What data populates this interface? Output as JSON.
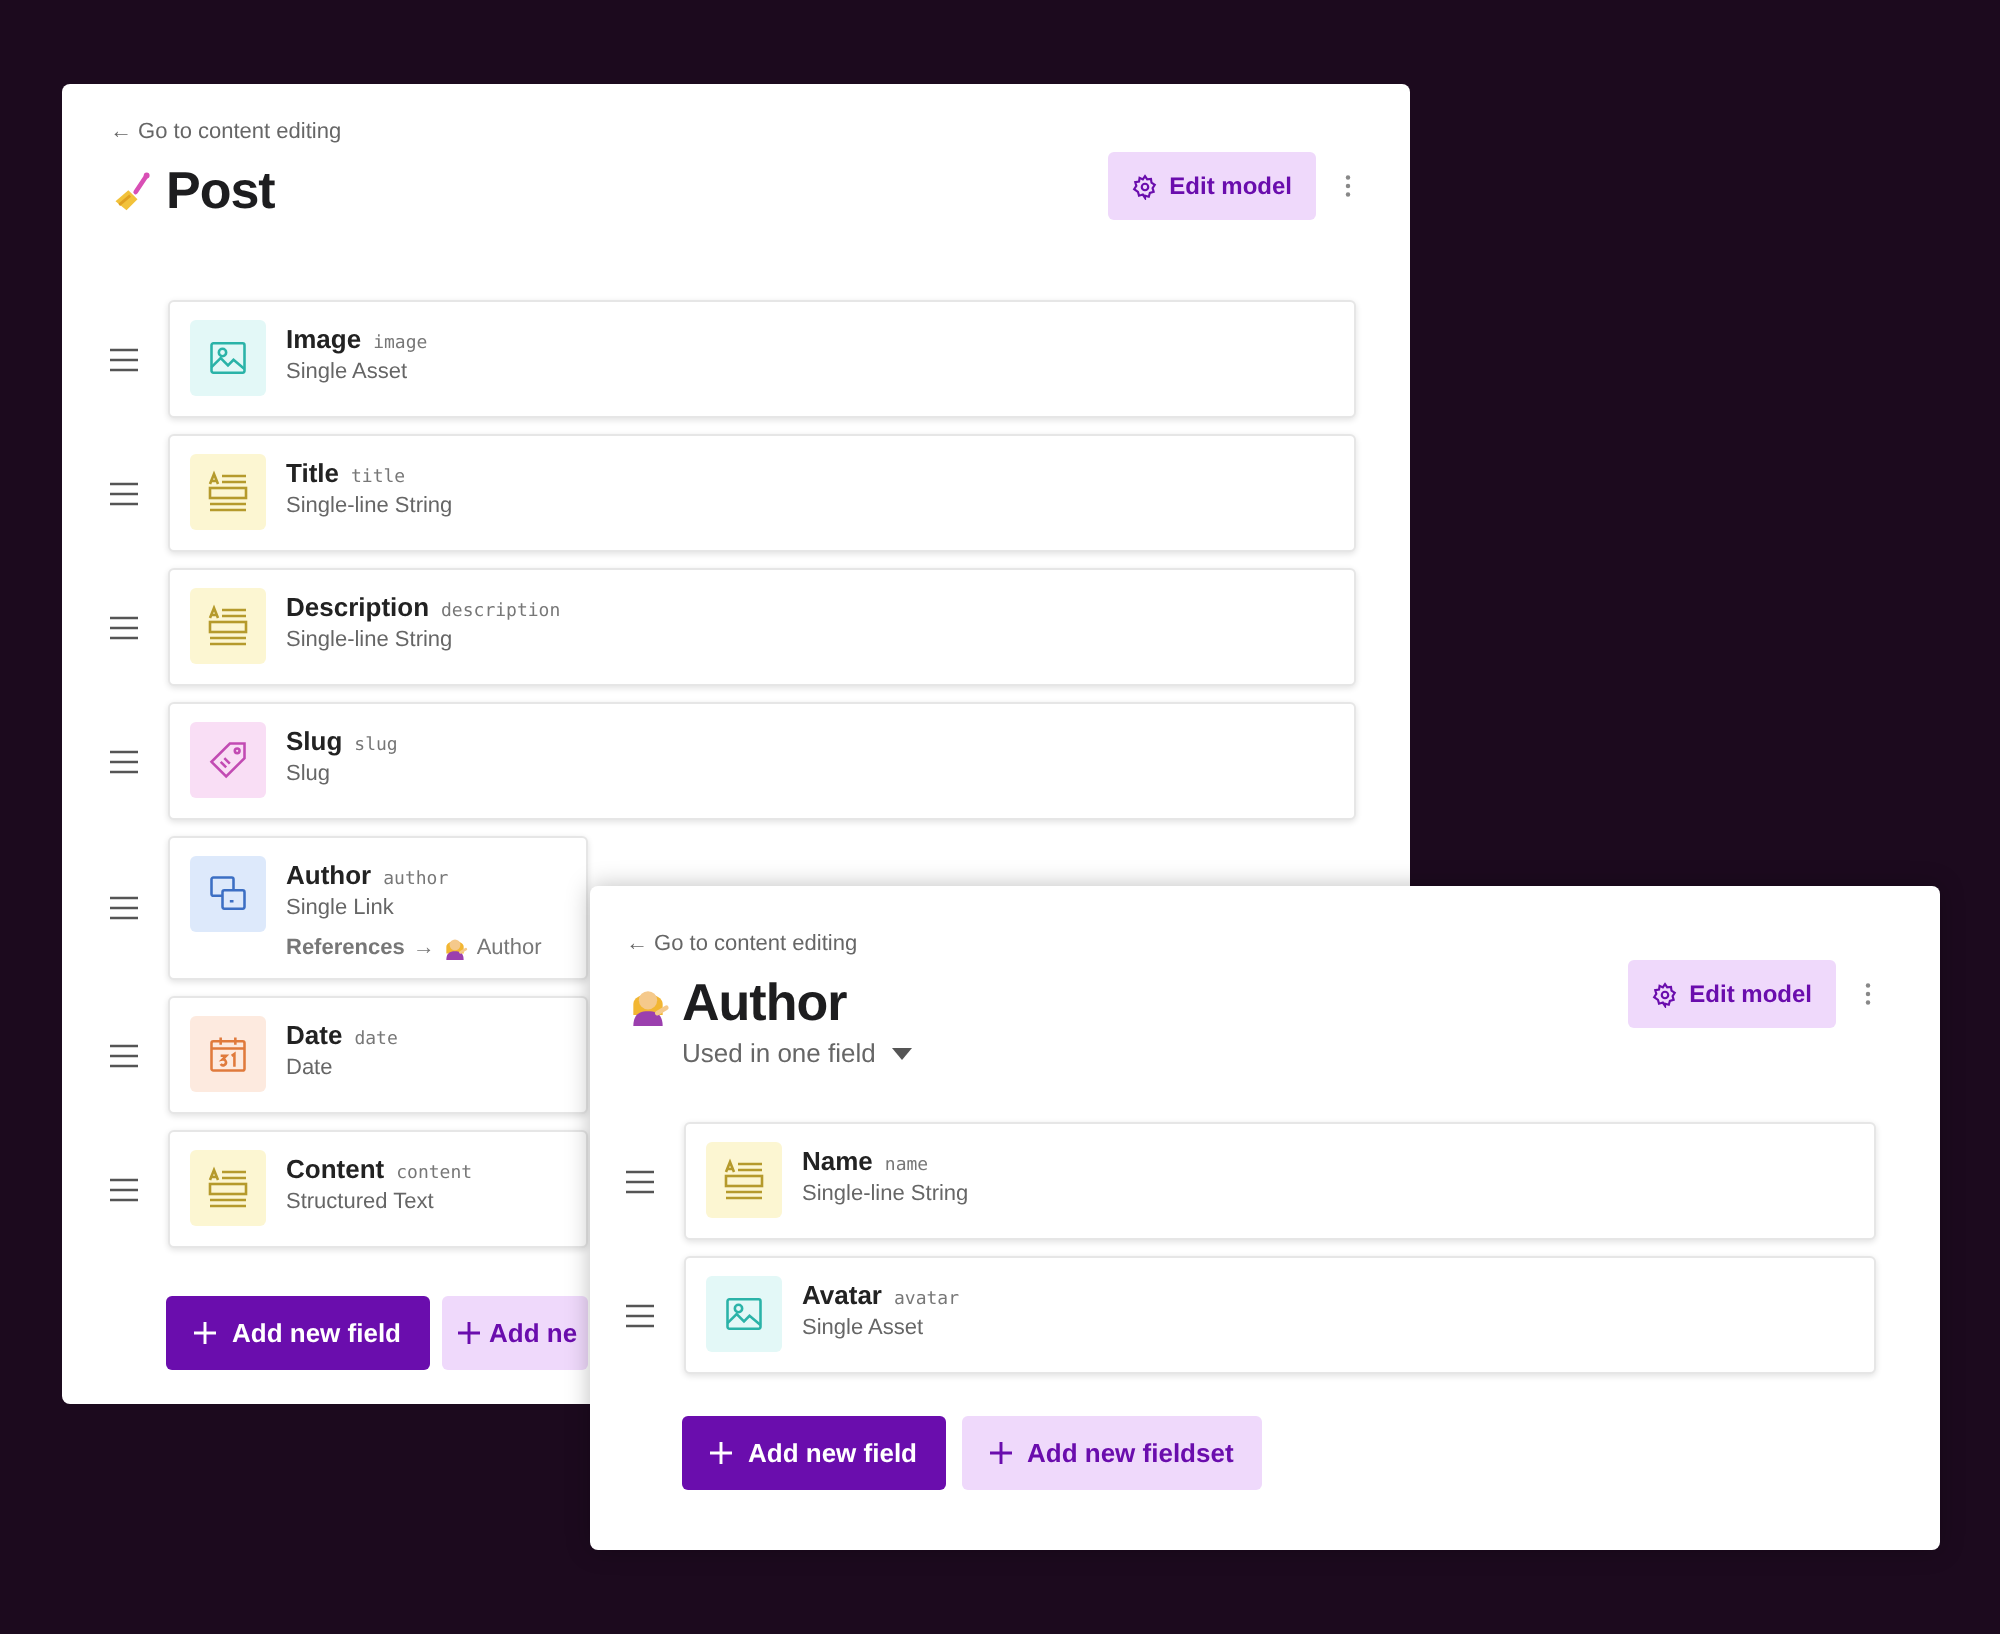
{
  "panels": [
    {
      "back_link": "← Go to content editing",
      "title": "Post",
      "icon": {
        "kind": "polish"
      },
      "edit_button": "Edit model",
      "fields": [
        {
          "kind": "image",
          "label": "Image",
          "api_key": "image",
          "type": "Single Asset"
        },
        {
          "kind": "string",
          "label": "Title",
          "api_key": "title",
          "type": "Single-line String"
        },
        {
          "kind": "string",
          "label": "Description",
          "api_key": "description",
          "type": "Single-line String"
        },
        {
          "kind": "slug",
          "label": "Slug",
          "api_key": "slug",
          "type": "Slug"
        },
        {
          "kind": "link",
          "label": "Author",
          "api_key": "author",
          "type": "Single Link",
          "reference": {
            "label": "References",
            "arrow": "→",
            "target": "Author"
          }
        },
        {
          "kind": "date",
          "label": "Date",
          "api_key": "date",
          "type": "Date"
        },
        {
          "kind": "string",
          "label": "Content",
          "api_key": "content",
          "type": "Structured Text"
        }
      ],
      "buttons": [
        {
          "kind": "primary",
          "label": "Add new field"
        },
        {
          "kind": "secondary",
          "label": "Add ne"
        }
      ]
    },
    {
      "back_link": "← Go to content editing",
      "title": "Author",
      "icon": {
        "kind": "person"
      },
      "subtitle": "Used in one field",
      "edit_button": "Edit model",
      "fields": [
        {
          "kind": "string",
          "label": "Name",
          "api_key": "name",
          "type": "Single-line String"
        },
        {
          "kind": "image",
          "label": "Avatar",
          "api_key": "avatar",
          "type": "Single Asset"
        }
      ],
      "buttons": [
        {
          "kind": "primary",
          "label": "Add new field"
        },
        {
          "kind": "secondary",
          "label": "Add new fieldset"
        }
      ]
    }
  ]
}
